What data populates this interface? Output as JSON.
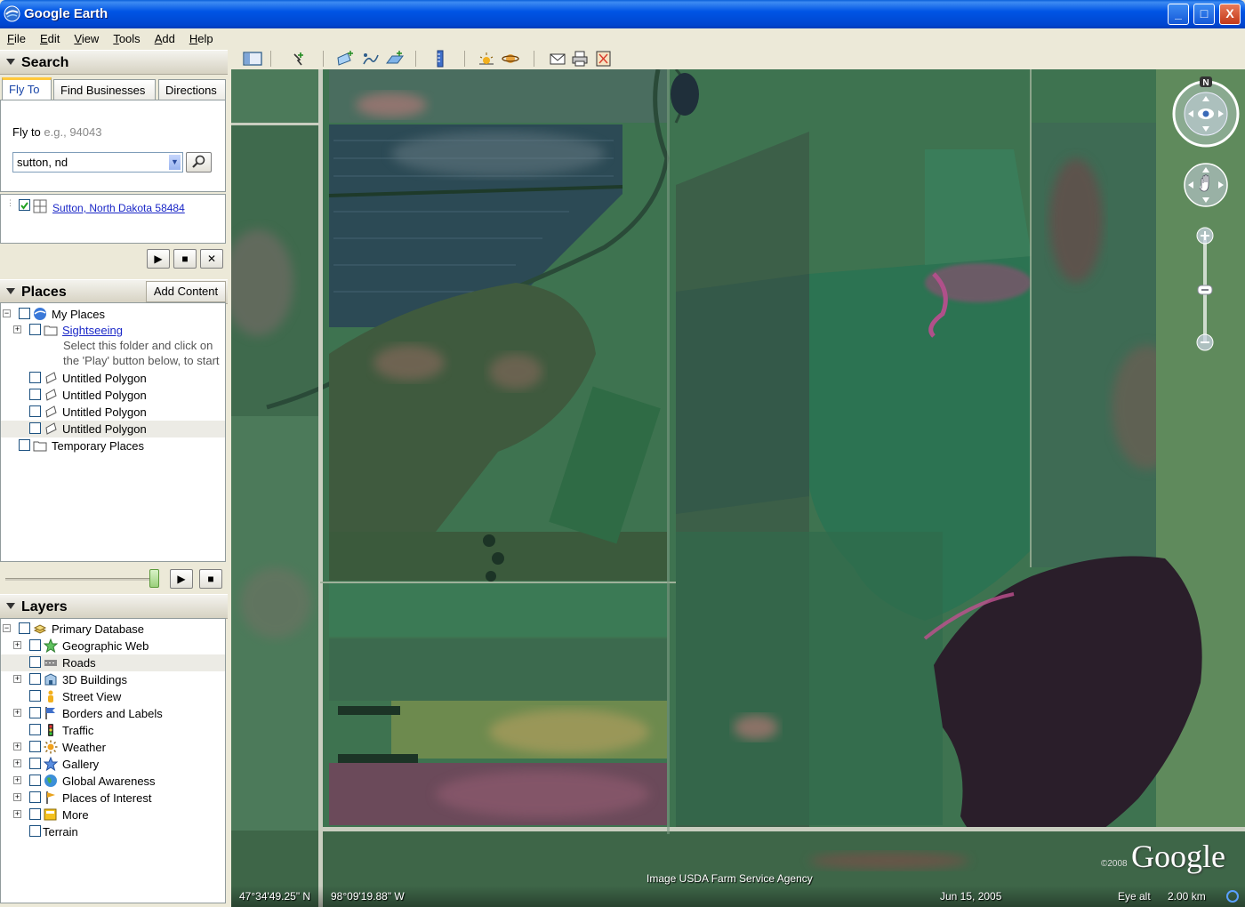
{
  "window": {
    "title": "Google Earth",
    "buttons": [
      "_",
      "□",
      "X"
    ]
  },
  "menu": [
    "File",
    "Edit",
    "View",
    "Tools",
    "Add",
    "Help"
  ],
  "search": {
    "header": "Search",
    "tabs": [
      "Fly To",
      "Find Businesses",
      "Directions"
    ],
    "fly_label": "Fly to",
    "fly_hint": "e.g., 94043",
    "input_value": "sutton, nd",
    "result": "Sutton, North Dakota 58484"
  },
  "places": {
    "header": "Places",
    "add_content": "Add Content",
    "items": [
      {
        "label": "My Places",
        "icon": "globe-icon"
      },
      {
        "label": "Sightseeing",
        "icon": "folder-icon",
        "link": true
      },
      {
        "label": "Untitled Polygon",
        "icon": "polygon-icon"
      },
      {
        "label": "Untitled Polygon",
        "icon": "polygon-icon"
      },
      {
        "label": "Untitled Polygon",
        "icon": "polygon-icon"
      },
      {
        "label": "Untitled Polygon",
        "icon": "polygon-icon",
        "selected": true
      },
      {
        "label": "Temporary Places",
        "icon": "folder-icon"
      }
    ],
    "note": "Select this folder and click on the 'Play' button below, to start"
  },
  "layers": {
    "header": "Layers",
    "items": [
      {
        "label": "Primary Database",
        "icon": "database-icon"
      },
      {
        "label": "Geographic Web",
        "icon": "star-icon"
      },
      {
        "label": "Roads",
        "icon": "road-icon"
      },
      {
        "label": "3D Buildings",
        "icon": "building-icon"
      },
      {
        "label": "Street View",
        "icon": "person-icon"
      },
      {
        "label": "Borders and Labels",
        "icon": "flag-icon"
      },
      {
        "label": "Traffic",
        "icon": "traffic-light-icon"
      },
      {
        "label": "Weather",
        "icon": "sun-icon"
      },
      {
        "label": "Gallery",
        "icon": "gallery-star-icon"
      },
      {
        "label": "Global Awareness",
        "icon": "earth-icon"
      },
      {
        "label": "Places of Interest",
        "icon": "pin-flag-icon"
      },
      {
        "label": "More",
        "icon": "more-icon"
      },
      {
        "label": "Terrain",
        "icon": ""
      }
    ]
  },
  "status": {
    "latitude": "47°34'49.25\" N",
    "longitude": "98°09'19.88\" W",
    "attribution": "Image USDA Farm Service Agency",
    "date": "Jun 15, 2005",
    "eye_alt_label": "Eye alt",
    "eye_alt_value": "2.00 km",
    "logo": "Google",
    "copyright": "©2008"
  },
  "compass": {
    "north": "N"
  }
}
